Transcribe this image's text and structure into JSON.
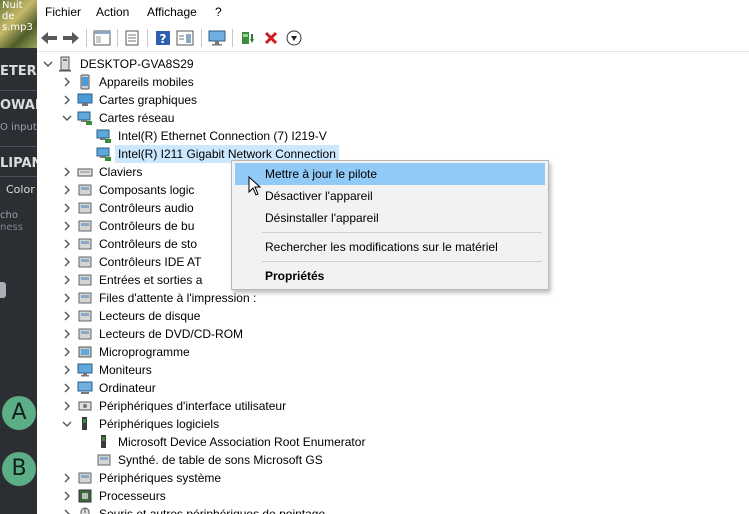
{
  "background_app": {
    "thumb_text": [
      "Nuit de",
      "s.mp3"
    ],
    "labels": [
      "ETER",
      "OWAR",
      "O input",
      "LIPAN",
      "Color",
      "cho",
      "ness"
    ],
    "buttons": [
      "A",
      "B"
    ]
  },
  "menu": [
    "Fichier",
    "Action",
    "Affichage",
    "?"
  ],
  "toolbar": {
    "icons": [
      "back-arrow-icon",
      "forward-arrow-icon",
      "show-hide-console-icon",
      "properties-icon",
      "help-icon",
      "action-pane-icon",
      "monitor-icon",
      "update-driver-icon",
      "uninstall-icon",
      "download-icon"
    ]
  },
  "tree": {
    "root": "DESKTOP-GVA8S29",
    "rows": [
      {
        "label": "Appareils mobiles",
        "level": 1,
        "expander": "collapsed",
        "icon": "mobile-device-icon"
      },
      {
        "label": "Cartes graphiques",
        "level": 1,
        "expander": "collapsed",
        "icon": "display-adapter-icon"
      },
      {
        "label": "Cartes réseau",
        "level": 1,
        "expander": "expanded",
        "icon": "network-adapter-icon"
      },
      {
        "label": "Intel(R) Ethernet Connection (7) I219-V",
        "level": 2,
        "expander": "none",
        "icon": "network-adapter-icon"
      },
      {
        "label": "Intel(R) I211 Gigabit Network Connection",
        "level": 2,
        "expander": "none",
        "icon": "network-adapter-icon",
        "selected": true
      },
      {
        "label": "Claviers",
        "level": 1,
        "expander": "collapsed",
        "icon": "keyboard-icon"
      },
      {
        "label": "Composants logic",
        "level": 1,
        "expander": "collapsed",
        "icon": "software-component-icon"
      },
      {
        "label": "Contrôleurs audio",
        "level": 1,
        "expander": "collapsed",
        "icon": "audio-controller-icon"
      },
      {
        "label": "Contrôleurs de bu",
        "level": 1,
        "expander": "collapsed",
        "icon": "usb-controller-icon"
      },
      {
        "label": "Contrôleurs de sto",
        "level": 1,
        "expander": "collapsed",
        "icon": "storage-controller-icon"
      },
      {
        "label": "Contrôleurs IDE AT",
        "level": 1,
        "expander": "collapsed",
        "icon": "ide-controller-icon"
      },
      {
        "label": "Entrées et sorties a",
        "level": 1,
        "expander": "collapsed",
        "icon": "audio-io-icon"
      },
      {
        "label": "Files d'attente à l'impression :",
        "level": 1,
        "expander": "collapsed",
        "icon": "print-queue-icon"
      },
      {
        "label": "Lecteurs de disque",
        "level": 1,
        "expander": "collapsed",
        "icon": "disk-drive-icon"
      },
      {
        "label": "Lecteurs de DVD/CD-ROM",
        "level": 1,
        "expander": "collapsed",
        "icon": "dvd-drive-icon"
      },
      {
        "label": "Microprogramme",
        "level": 1,
        "expander": "collapsed",
        "icon": "firmware-icon"
      },
      {
        "label": "Moniteurs",
        "level": 1,
        "expander": "collapsed",
        "icon": "monitor-icon"
      },
      {
        "label": "Ordinateur",
        "level": 1,
        "expander": "collapsed",
        "icon": "computer-icon"
      },
      {
        "label": "Périphériques d'interface utilisateur",
        "level": 1,
        "expander": "collapsed",
        "icon": "hid-icon"
      },
      {
        "label": "Périphériques logiciels",
        "level": 1,
        "expander": "expanded",
        "icon": "software-device-icon"
      },
      {
        "label": "Microsoft Device Association Root Enumerator",
        "level": 2,
        "expander": "none",
        "icon": "software-device-icon"
      },
      {
        "label": "Synthé. de table de sons Microsoft GS",
        "level": 2,
        "expander": "none",
        "icon": "sound-synth-icon"
      },
      {
        "label": "Périphériques système",
        "level": 1,
        "expander": "collapsed",
        "icon": "system-device-icon"
      },
      {
        "label": "Processeurs",
        "level": 1,
        "expander": "collapsed",
        "icon": "processor-icon"
      },
      {
        "label": "Souris et autres périphériques de pointage",
        "level": 1,
        "expander": "collapsed",
        "icon": "mouse-icon"
      }
    ]
  },
  "context_menu": {
    "items": [
      {
        "label": "Mettre à jour le pilote",
        "highlighted": true
      },
      {
        "label": "Désactiver l'appareil"
      },
      {
        "label": "Désinstaller l'appareil"
      },
      {
        "label": "Rechercher les modifications sur le matériel"
      },
      {
        "label": "Propriétés",
        "bold": true
      }
    ]
  },
  "colors": {
    "selection": "#cce8ff",
    "menu_highlight": "#91c9f7",
    "menu_bg": "#f2f2f2"
  }
}
